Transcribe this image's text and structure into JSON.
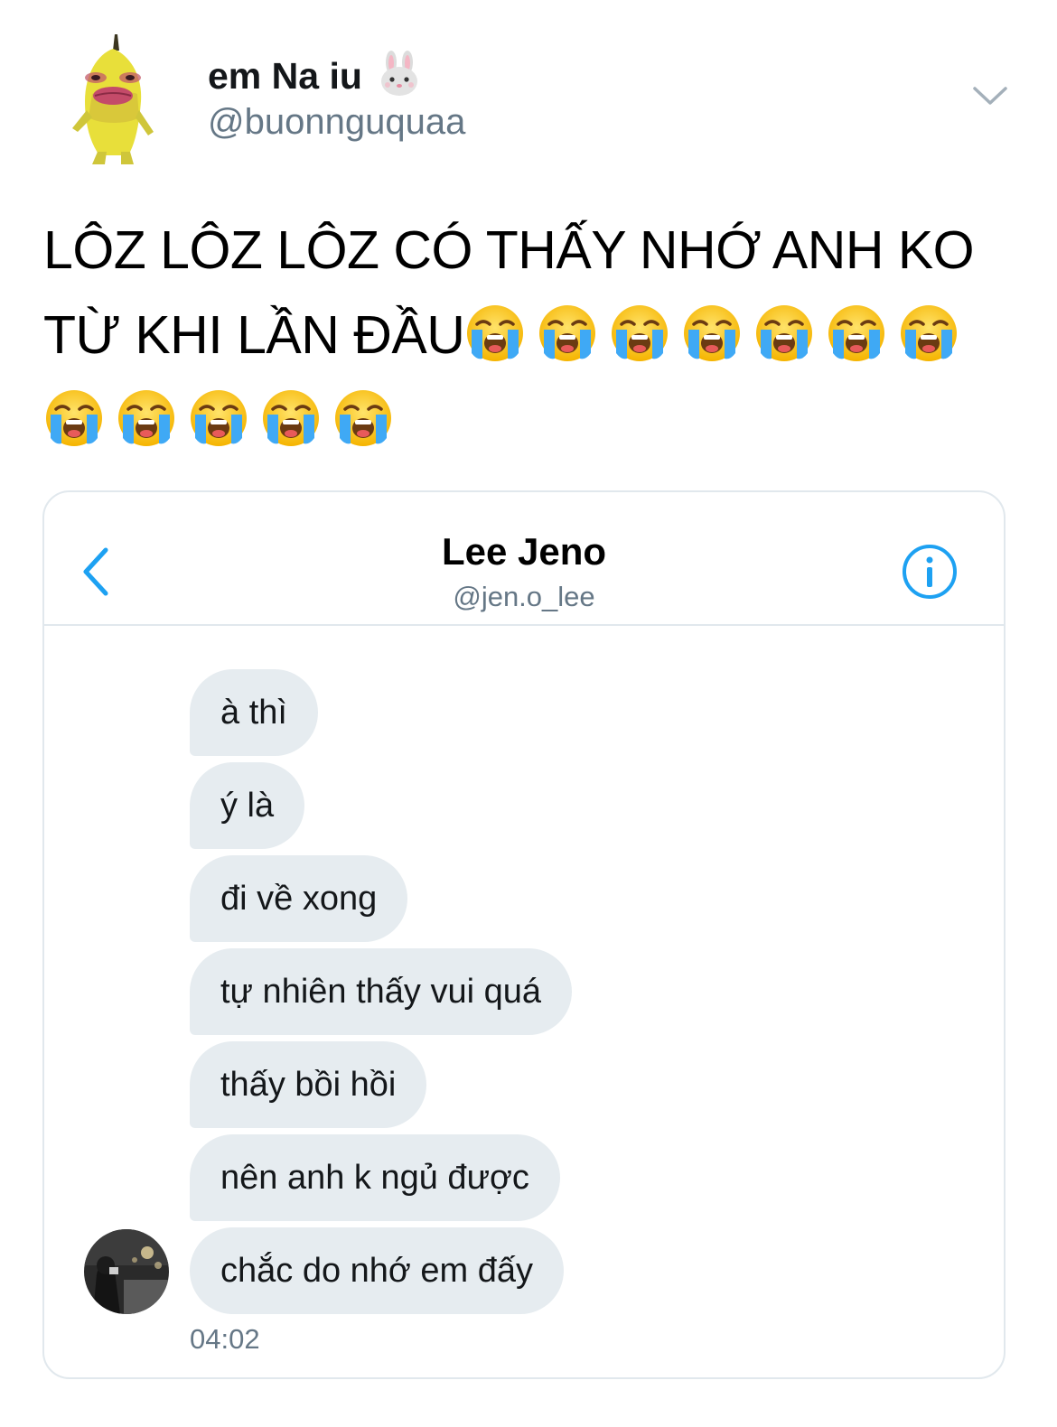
{
  "tweet": {
    "author": {
      "display_name": "em Na iu",
      "name_emoji": "rabbit-face-icon",
      "handle": "@buonnguquaa",
      "avatar": "banana-avatar"
    },
    "text_lines": [
      "LÔZ LÔZ LÔZ CÓ THẤY NHỚ ANH KO",
      "TỪ KHI LẦN ĐẦU"
    ],
    "emoji": "loudly-crying-face-icon",
    "emoji_count_line2": 7,
    "emoji_count_line3": 5,
    "menu_icon": "chevron-down-icon"
  },
  "dm": {
    "back_icon": "chevron-left-icon",
    "contact_name": "Lee Jeno",
    "contact_handle": "@jen.o_lee",
    "info_icon": "info-icon",
    "messages": [
      "à thì",
      "ý là",
      "đi về xong",
      "tự nhiên thấy vui quá",
      "thấy bồi hồi",
      "nên anh k ngủ được",
      "chắc do nhớ em đấy"
    ],
    "timestamp": "04:02"
  },
  "colors": {
    "accent": "#1da1f2",
    "secondary_text": "#657786",
    "bubble": "#e6ecf0",
    "border": "#e1e8ed"
  }
}
